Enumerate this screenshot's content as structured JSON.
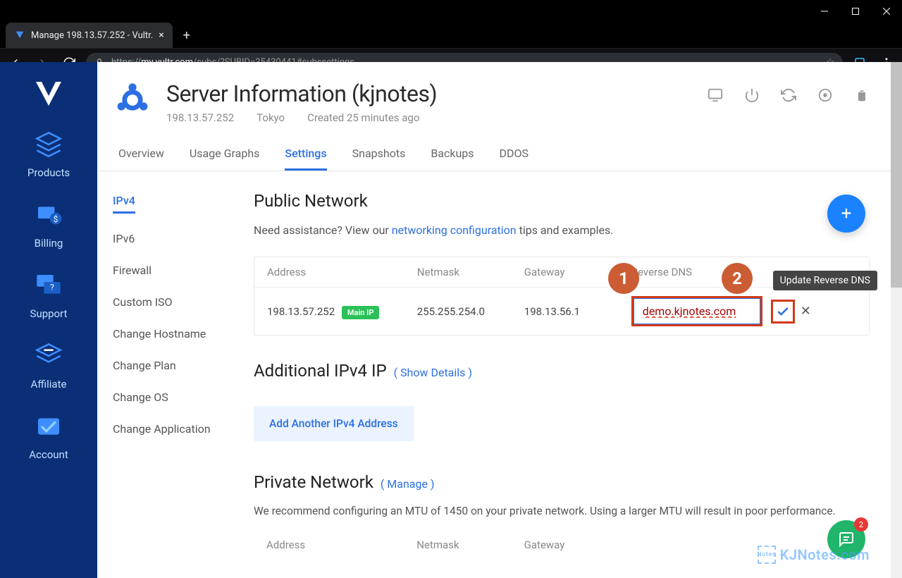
{
  "window": {
    "tab_title": "Manage 198.13.57.252 - Vultr.",
    "url": "https://my.vultr.com/subs/?SUBID=35430441#subssettings",
    "url_proto": "https://",
    "url_host": "my.vultr.com",
    "url_path": "/subs/?SUBID=35430441#subssettings"
  },
  "sidebar": {
    "items": [
      {
        "label": "Products"
      },
      {
        "label": "Billing"
      },
      {
        "label": "Support"
      },
      {
        "label": "Affiliate"
      },
      {
        "label": "Account"
      }
    ]
  },
  "header": {
    "title": "Server Information (kjnotes)",
    "ip": "198.13.57.252",
    "location": "Tokyo",
    "created": "Created 25 minutes ago"
  },
  "tabs": [
    "Overview",
    "Usage Graphs",
    "Settings",
    "Snapshots",
    "Backups",
    "DDOS"
  ],
  "active_tab": "Settings",
  "subnav": [
    "IPv4",
    "IPv6",
    "Firewall",
    "Custom ISO",
    "Change Hostname",
    "Change Plan",
    "Change OS",
    "Change Application"
  ],
  "active_subnav": "IPv4",
  "public_network": {
    "title": "Public Network",
    "desc_pre": "Need assistance? View our ",
    "desc_link": "networking configuration",
    "desc_post": " tips and examples.",
    "columns": [
      "Address",
      "Netmask",
      "Gateway",
      "Reverse DNS"
    ],
    "row": {
      "address": "198.13.57.252",
      "main_badge": "Main IP",
      "netmask": "255.255.254.0",
      "gateway": "198.13.56.1",
      "rdns_value": "demo.kjnotes.com",
      "tooltip": "Update Reverse DNS"
    }
  },
  "additional": {
    "title": "Additional IPv4 IP",
    "show_details": "( Show Details )",
    "button": "Add Another IPv4 Address"
  },
  "private_network": {
    "title": "Private Network",
    "manage": "( Manage )",
    "desc": "We recommend configuring an MTU of 1450 on your private network. Using a larger MTU will result in poor performance.",
    "columns": [
      "Address",
      "Netmask",
      "Gateway"
    ]
  },
  "annotations": {
    "one": "1",
    "two": "2"
  },
  "chat": {
    "badge": "2"
  },
  "watermark": "KJNotes.com"
}
